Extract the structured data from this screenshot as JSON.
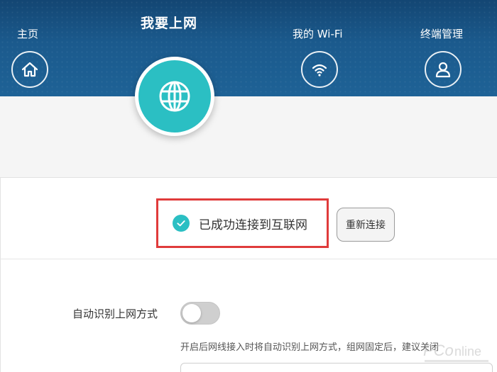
{
  "nav": {
    "home": {
      "label": "主页",
      "icon": "home-icon"
    },
    "internet": {
      "label": "我要上网",
      "icon": "globe-icon",
      "active": true
    },
    "wifi": {
      "label": "我的 Wi-Fi",
      "icon": "wifi-icon"
    },
    "devices": {
      "label": "终端管理",
      "icon": "user-icon"
    }
  },
  "status": {
    "text": "已成功连接到互联网",
    "icon": "check-circle-icon"
  },
  "reconnect_button": "重新连接",
  "auto_detect": {
    "label": "自动识别上网方式",
    "enabled": false,
    "hint": "开启后网线接入时将自动识别上网方式，组网固定后，建议关闭"
  },
  "colors": {
    "header": "#1b5a8d",
    "accent": "#2bbfc3",
    "highlight_border": "#e03b3b"
  }
}
